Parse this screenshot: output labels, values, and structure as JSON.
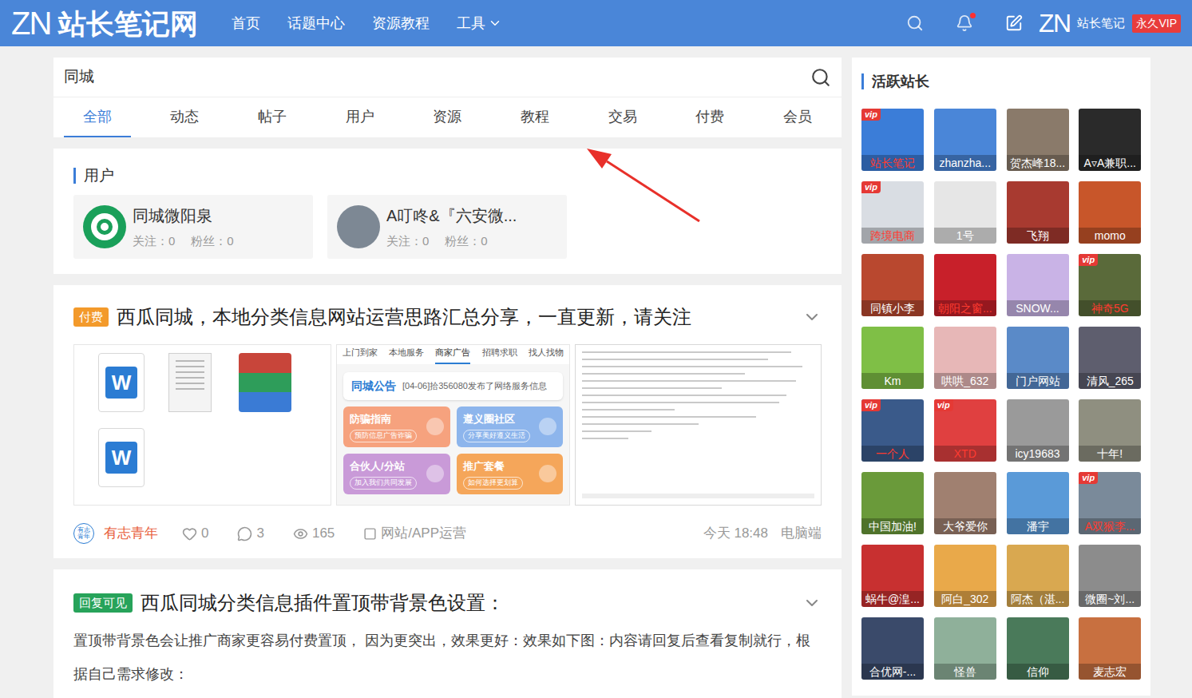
{
  "header": {
    "logo_mark": "ZN",
    "logo_text": "站长笔记网",
    "nav": [
      {
        "label": "首页",
        "dropdown": false
      },
      {
        "label": "话题中心",
        "dropdown": false
      },
      {
        "label": "资源教程",
        "dropdown": false
      },
      {
        "label": "工具",
        "dropdown": true
      }
    ],
    "notifications_unread": true,
    "user": {
      "avatar_mark": "ZN",
      "name": "站长笔记",
      "badge": "永久VIP"
    }
  },
  "search": {
    "value": "同城",
    "tabs": [
      {
        "label": "全部",
        "selected": true
      },
      {
        "label": "动态",
        "selected": false
      },
      {
        "label": "帖子",
        "selected": false
      },
      {
        "label": "用户",
        "selected": false
      },
      {
        "label": "资源",
        "selected": false
      },
      {
        "label": "教程",
        "selected": false
      },
      {
        "label": "交易",
        "selected": false
      },
      {
        "label": "付费",
        "selected": false
      },
      {
        "label": "会员",
        "selected": false
      }
    ]
  },
  "user_results": {
    "title": "用户",
    "users": [
      {
        "name": "同城微阳泉",
        "follows": "关注：0",
        "fans": "粉丝：0",
        "kind": "logo",
        "avatar_color": "#1aa05a"
      },
      {
        "name": "A叮咚&『六安微...",
        "follows": "关注：0",
        "fans": "粉丝：0",
        "kind": "photo",
        "avatar_color": "#7d8894"
      }
    ]
  },
  "posts": [
    {
      "badge": "付费",
      "badge_color": "#f39a2b",
      "title": "西瓜同城，本地分类信息网站运营思路汇总分享，一直更新，请关注",
      "expanded": false,
      "attachments": {
        "files": [
          {
            "kind": "word",
            "mark": "W"
          },
          {
            "kind": "text"
          },
          {
            "kind": "zip"
          },
          {
            "kind": "word",
            "mark": "W"
          }
        ],
        "app_preview": {
          "tabs": [
            {
              "label": "上门到家",
              "selected": false
            },
            {
              "label": "本地服务",
              "selected": false
            },
            {
              "label": "商家广告",
              "selected": true
            },
            {
              "label": "招聘求职",
              "selected": false
            },
            {
              "label": "找人找物",
              "selected": false
            }
          ],
          "notice_title": "同城公告",
          "notice_text": "[04-06]拾356080发布了网络服务信息",
          "tiles": [
            {
              "title": "防骗指南",
              "subtitle": "预防信息广告诈骗",
              "color": "#f6a27e"
            },
            {
              "title": "遵义圈社区",
              "subtitle": "分享美好遵义生活",
              "color": "#8db5ec"
            },
            {
              "title": "合伙人/分站",
              "subtitle": "加入我们共同发展",
              "color": "#c99ad8"
            },
            {
              "title": "推广套餐",
              "subtitle": "如何选择更划算",
              "color": "#f5a65a"
            }
          ]
        }
      },
      "author": "有志青年",
      "author_avatar": "有志青年",
      "likes": "0",
      "comments": "3",
      "views": "165",
      "category": "网站/APP运营",
      "time": "今天 18:48",
      "device": "电脑端"
    },
    {
      "badge": "回复可见",
      "badge_color": "#27a35a",
      "title": "西瓜同城分类信息插件置顶带背景色设置：",
      "expanded": false,
      "excerpt": "置顶带背景色会让推广商家更容易付费置顶， 因为更突出，效果更好：效果如下图：内容请回复后查看复制就行，根据自己需求修改："
    }
  ],
  "sidebar": {
    "title": "活跃站长",
    "vip_badge": "vip",
    "members": [
      {
        "name": "站长笔记",
        "vip": true,
        "name_red": true,
        "color": "#3b7dd8"
      },
      {
        "name": "zhanzha...",
        "vip": false,
        "name_red": false,
        "color": "#4a86d8"
      },
      {
        "name": "贺杰峰18...",
        "vip": false,
        "name_red": false,
        "color": "#8a7a6a"
      },
      {
        "name": "A▿A兼职...",
        "vip": false,
        "name_red": false,
        "color": "#2a2a2a"
      },
      {
        "name": "跨境电商",
        "vip": true,
        "name_red": true,
        "color": "#d9dde3"
      },
      {
        "name": "1号",
        "vip": false,
        "name_red": false,
        "color": "#e6e6e6"
      },
      {
        "name": "飞翔",
        "vip": false,
        "name_red": false,
        "color": "#a83a30"
      },
      {
        "name": "momo",
        "vip": false,
        "name_red": false,
        "color": "#c8562a"
      },
      {
        "name": "同镇小李",
        "vip": false,
        "name_red": false,
        "color": "#b9482f"
      },
      {
        "name": "朝阳之窗...",
        "vip": false,
        "name_red": true,
        "color": "#c8202a"
      },
      {
        "name": "SNOW...",
        "vip": false,
        "name_red": false,
        "color": "#c9b3e6"
      },
      {
        "name": "神奇5G",
        "vip": true,
        "name_red": true,
        "color": "#5a6a3a"
      },
      {
        "name": "Km",
        "vip": false,
        "name_red": false,
        "color": "#7fbf46"
      },
      {
        "name": "哄哄_632",
        "vip": false,
        "name_red": false,
        "color": "#e7b7b7"
      },
      {
        "name": "门户网站",
        "vip": false,
        "name_red": false,
        "color": "#5a8ac8"
      },
      {
        "name": "清风_265",
        "vip": false,
        "name_red": false,
        "color": "#5e5e6e"
      },
      {
        "name": "一个人",
        "vip": true,
        "name_red": true,
        "color": "#3a5a8a"
      },
      {
        "name": "XTD",
        "vip": true,
        "name_red": true,
        "color": "#e04040"
      },
      {
        "name": "icy19683",
        "vip": false,
        "name_red": false,
        "color": "#9a9a9a"
      },
      {
        "name": "十年!",
        "vip": false,
        "name_red": false,
        "color": "#8f8f80"
      },
      {
        "name": "中国加油!",
        "vip": false,
        "name_red": false,
        "color": "#6a9a3a"
      },
      {
        "name": "大爷爱你",
        "vip": false,
        "name_red": false,
        "color": "#a08070"
      },
      {
        "name": "潘宇",
        "vip": false,
        "name_red": false,
        "color": "#5a9ad8"
      },
      {
        "name": "A双猴李...",
        "vip": true,
        "name_red": true,
        "color": "#7a8a9a"
      },
      {
        "name": "蜗牛@湟...",
        "vip": false,
        "name_red": false,
        "color": "#c83030"
      },
      {
        "name": "阿白_302",
        "vip": false,
        "name_red": false,
        "color": "#e9a94a"
      },
      {
        "name": "阿杰（湛...",
        "vip": false,
        "name_red": false,
        "color": "#d9a850"
      },
      {
        "name": "微圈~刘...",
        "vip": false,
        "name_red": false,
        "color": "#8c8c8c"
      },
      {
        "name": "合优网-...",
        "vip": false,
        "name_red": false,
        "color": "#3a4a6a"
      },
      {
        "name": "怪兽",
        "vip": false,
        "name_red": false,
        "color": "#8fb09a"
      },
      {
        "name": "信仰",
        "vip": false,
        "name_red": false,
        "color": "#4a7a5a"
      },
      {
        "name": "麦志宏",
        "vip": false,
        "name_red": false,
        "color": "#c87040"
      }
    ]
  }
}
